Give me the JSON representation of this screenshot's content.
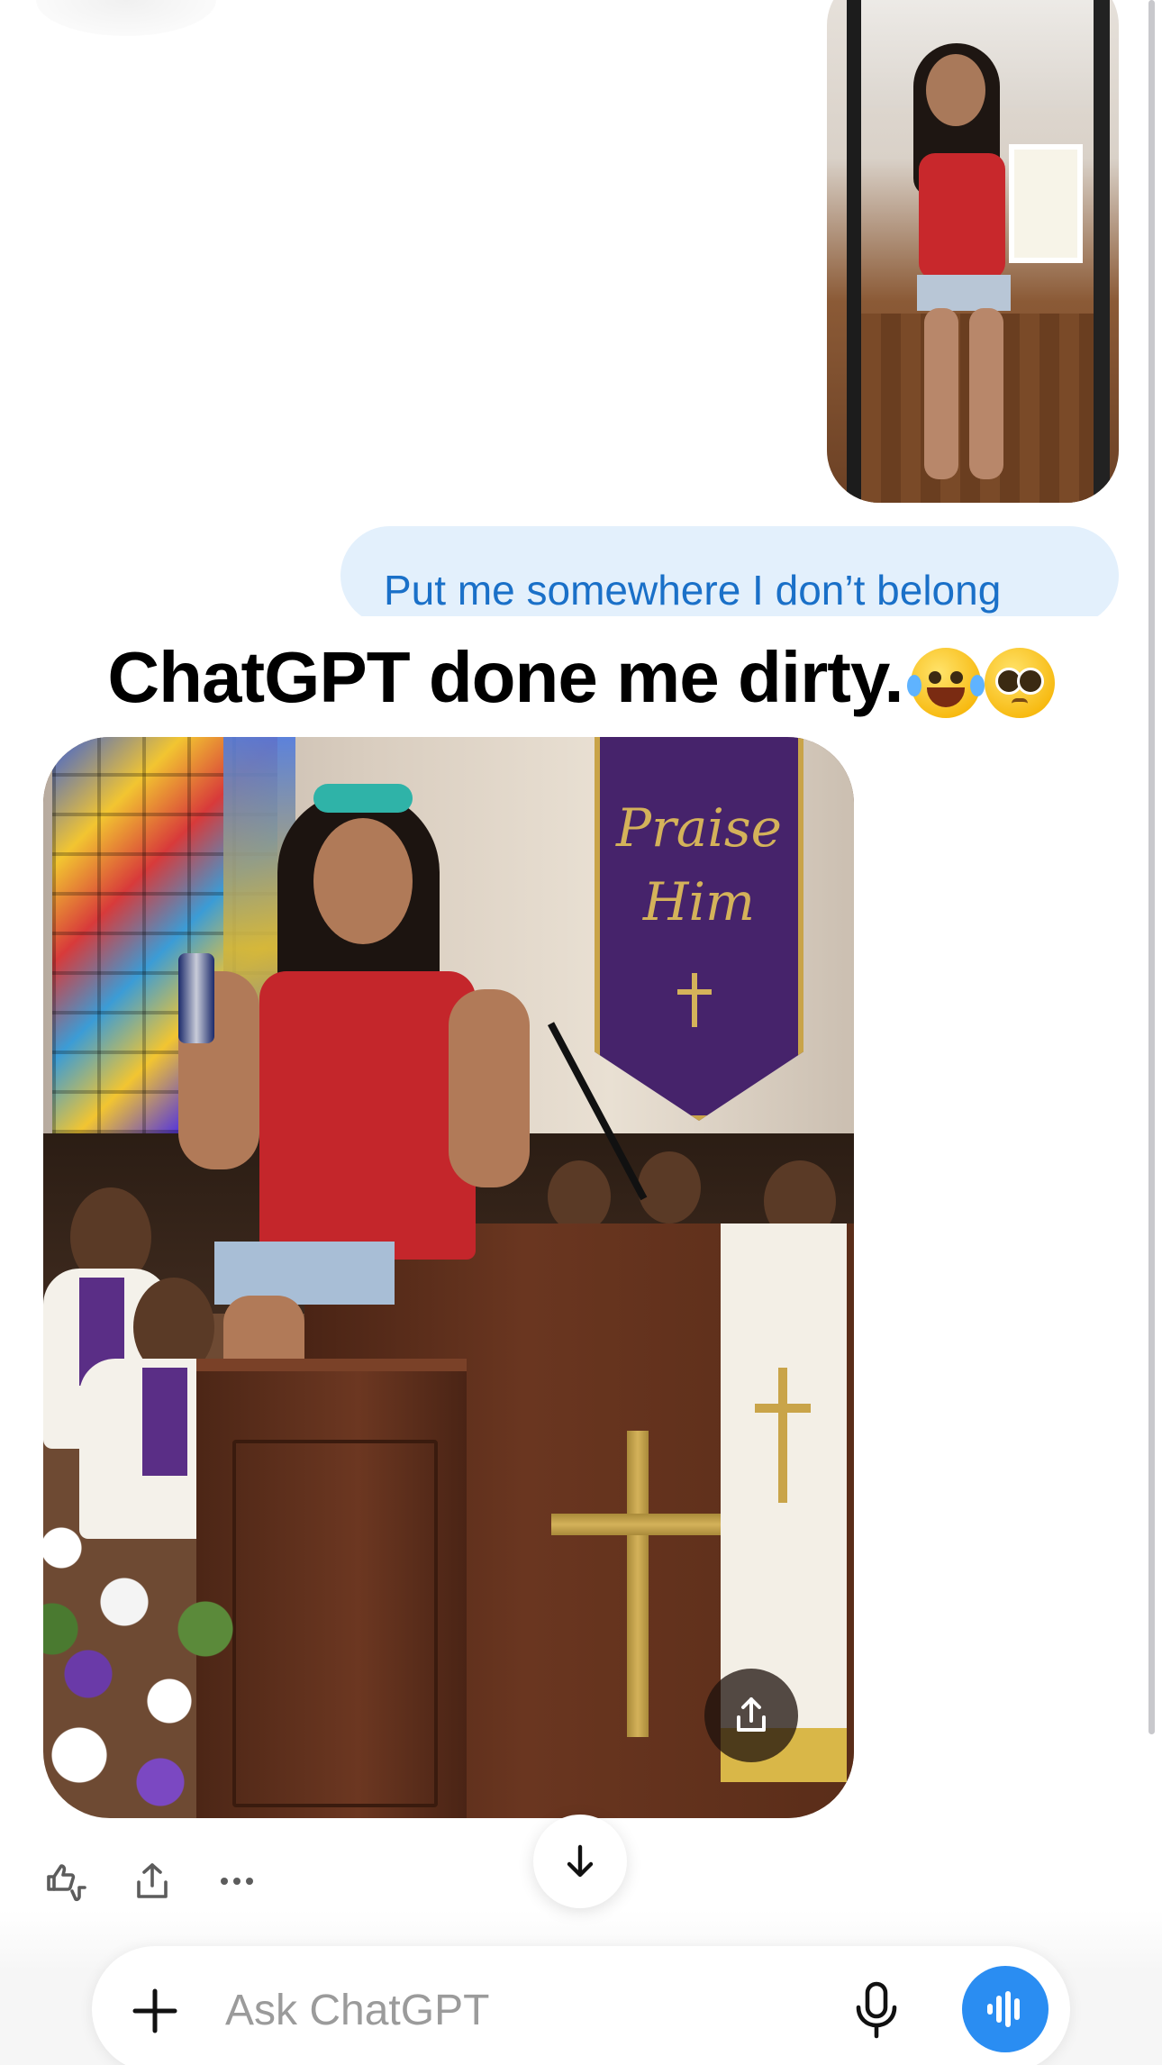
{
  "conversation": {
    "user_prompt": "Put me somewhere I don’t belong"
  },
  "overlay_caption": {
    "text": "ChatGPT done me dirty.",
    "emojis": [
      "face-with-tears-of-joy",
      "pleading-face"
    ]
  },
  "generated_image": {
    "banner_line_1": "Praise",
    "banner_line_2": "Him"
  },
  "message_actions": {
    "icons": [
      "thumbs-up-down-icon",
      "share-icon",
      "more-icon"
    ]
  },
  "composer": {
    "placeholder": "Ask ChatGPT"
  },
  "colors": {
    "user_bubble_bg": "#e3f0fc",
    "user_bubble_text": "#1a70c8",
    "voice_button": "#2a8df2"
  }
}
